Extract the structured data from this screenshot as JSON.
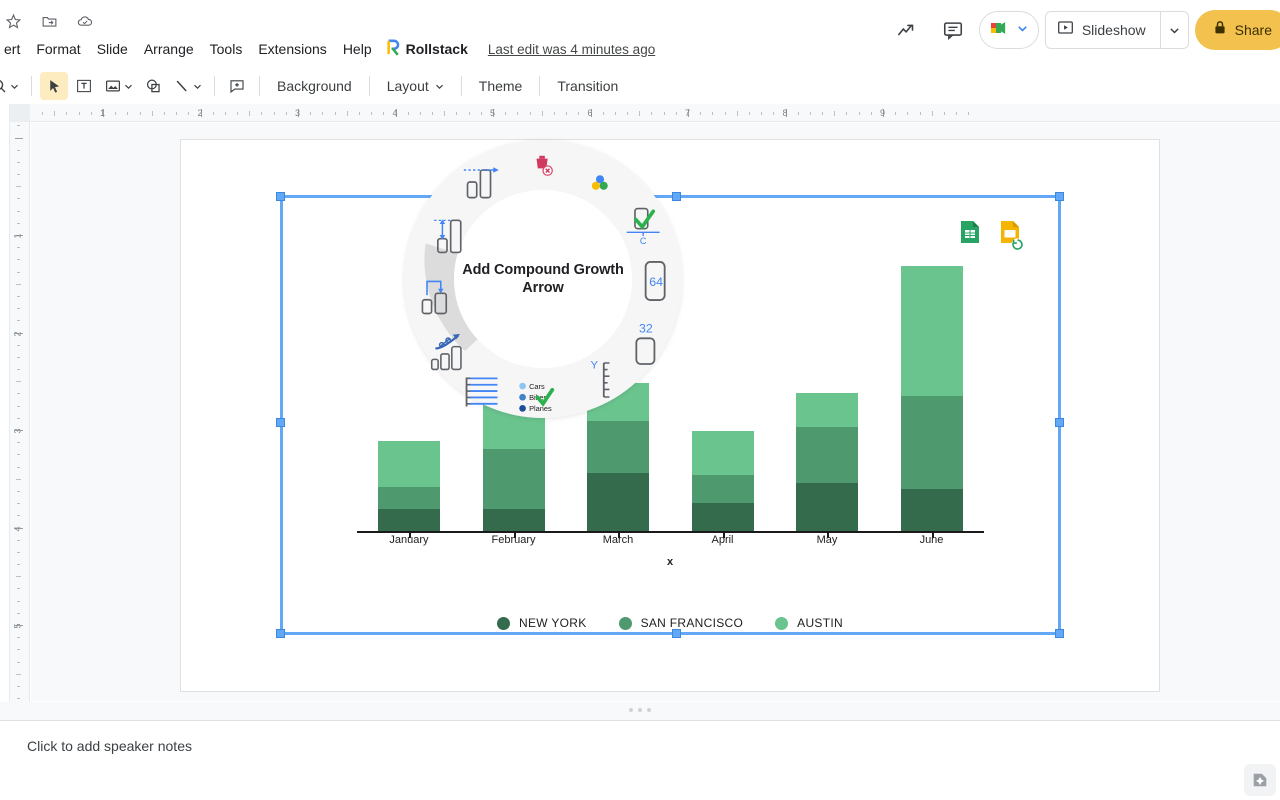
{
  "app": {
    "title": "Google Slides",
    "last_edit": "Last edit was 4 minutes ago"
  },
  "doc_icons": [
    {
      "name": "star-icon",
      "glyph": "☆"
    },
    {
      "name": "move-to-folder-icon",
      "glyph": "folder"
    },
    {
      "name": "cloud-saved-icon",
      "glyph": "cloud"
    }
  ],
  "menubar": {
    "items": [
      {
        "name": "insert",
        "label": "ert"
      },
      {
        "name": "format",
        "label": "Format"
      },
      {
        "name": "slide",
        "label": "Slide"
      },
      {
        "name": "arrange",
        "label": "Arrange"
      },
      {
        "name": "tools",
        "label": "Tools"
      },
      {
        "name": "extensions",
        "label": "Extensions"
      },
      {
        "name": "help",
        "label": "Help"
      }
    ],
    "rollstack_label": "Rollstack"
  },
  "topright": {
    "activity_icon": "trending-up-icon",
    "comment_icon": "comment-icon",
    "meet_icon": "google-meet-icon",
    "slideshow_label": "Slideshow",
    "share_label": "Share",
    "share_color": "#f2c14e"
  },
  "toolbar": {
    "items": [
      {
        "name": "select-tool",
        "type": "icon",
        "glyph": "cursor",
        "active": true
      },
      {
        "name": "textbox-tool",
        "type": "icon",
        "glyph": "textbox",
        "active": false
      },
      {
        "name": "image-tool",
        "type": "icon-caret",
        "glyph": "image",
        "active": false
      },
      {
        "name": "shape-tool",
        "type": "icon",
        "glyph": "shape",
        "active": false
      },
      {
        "name": "line-tool",
        "type": "icon-caret",
        "glyph": "line",
        "active": false
      },
      {
        "name": "comment-tool",
        "type": "icon",
        "glyph": "add-comment",
        "active": false
      }
    ],
    "text_buttons": [
      {
        "name": "background-button",
        "label": "Background",
        "caret": false
      },
      {
        "name": "layout-button",
        "label": "Layout",
        "caret": true
      },
      {
        "name": "theme-button",
        "label": "Theme",
        "caret": false
      },
      {
        "name": "transition-button",
        "label": "Transition",
        "caret": false
      }
    ]
  },
  "rulers": {
    "horizontal_numbers": [
      "1",
      "2",
      "3",
      "4",
      "5",
      "6",
      "7",
      "8",
      "9"
    ],
    "vertical_numbers": [
      "1",
      "2",
      "3",
      "4",
      "5"
    ]
  },
  "radial_menu": {
    "center_label": "Add Compound Growth Arrow",
    "items": [
      {
        "name": "delete-chart-item",
        "icon": "trash-red-icon"
      },
      {
        "name": "color-palette-item",
        "icon": "color-dots-icon"
      },
      {
        "name": "data-label-arrow-item",
        "icon": "bar-arrow-left-icon"
      },
      {
        "name": "checkbox-item",
        "icon": "bar-check-c-icon",
        "sub_label": "C"
      },
      {
        "name": "bar-gap-item",
        "icon": "bar-height-arrow-icon"
      },
      {
        "name": "value-64-item",
        "icon": "bar-value-icon",
        "value": "64"
      },
      {
        "name": "growth-bracket-item",
        "icon": "bar-bracket-icon"
      },
      {
        "name": "value-32-item",
        "icon": "bar-small-value-icon",
        "value": "32"
      },
      {
        "name": "compound-growth-item",
        "icon": "percent-growth-arrow-icon",
        "selected": true
      },
      {
        "name": "y-axis-item",
        "icon": "y-axis-icon",
        "sub_label": "Y"
      },
      {
        "name": "gridlines-item",
        "icon": "horizontal-lines-icon"
      },
      {
        "name": "legend-item",
        "icon": "legend-check-icon",
        "legend_entries": [
          "Cars",
          "Bikes",
          "Planes"
        ]
      }
    ]
  },
  "link_icons": [
    {
      "name": "google-sheets-link-icon",
      "color": "#27a463"
    },
    {
      "name": "google-slides-refresh-icon",
      "color": "#f4b400"
    }
  ],
  "chart_data": {
    "type": "bar",
    "subtype": "stacked",
    "title": "",
    "xlabel": "x",
    "ylabel": "",
    "categories": [
      "January",
      "February",
      "March",
      "April",
      "May",
      "June"
    ],
    "series": [
      {
        "name": "NEW YORK",
        "color": "#356b4d",
        "values": [
          22,
          22,
          58,
          28,
          48,
          42
        ]
      },
      {
        "name": "SAN FRANCISCO",
        "color": "#4e9a6e",
        "values": [
          22,
          60,
          52,
          28,
          56,
          93
        ]
      },
      {
        "name": "AUSTIN",
        "color": "#6ac48e",
        "values": [
          46,
          58,
          38,
          44,
          34,
          130
        ]
      }
    ],
    "legend_position": "bottom",
    "grid": false,
    "ylim": [
      0,
      270
    ],
    "axis_color": "#1a1a1a"
  },
  "selection": {
    "color": "#62a8f7",
    "handles": 8
  },
  "notes": {
    "placeholder": "Click to add speaker notes",
    "explore_icon": "explore-icon"
  }
}
